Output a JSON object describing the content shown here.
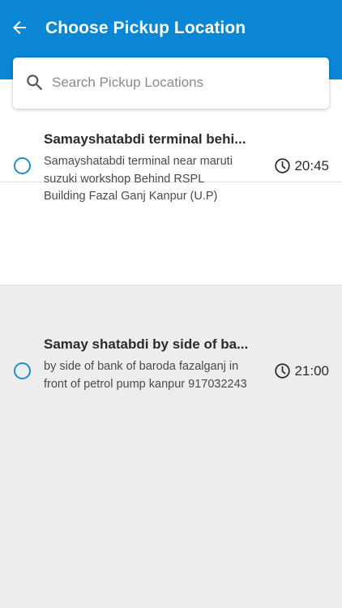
{
  "header": {
    "title": "Choose Pickup Location",
    "background_color": "#0a86d4",
    "back_icon": "arrow-left-icon"
  },
  "search": {
    "placeholder": "Search Pickup Locations",
    "value": "",
    "icon": "search-icon"
  },
  "locations": [
    {
      "name": "Samayshatabdi terminal behi...",
      "address": "Samayshatabdi terminal near maruti suzuki workshop Behind RSPL Building Fazal Ganj Kanpur (U.P)",
      "time": "20:45",
      "selected": false
    },
    {
      "name": "Samay shatabdi by side of ba...",
      "address": "by side of bank of baroda fazalganj in front of petrol pump kanpur 917032243",
      "time": "21:00",
      "selected": false
    }
  ],
  "colors": {
    "accent": "#0a86d4",
    "radio": "#1a8fc9",
    "background": "#ededed"
  }
}
